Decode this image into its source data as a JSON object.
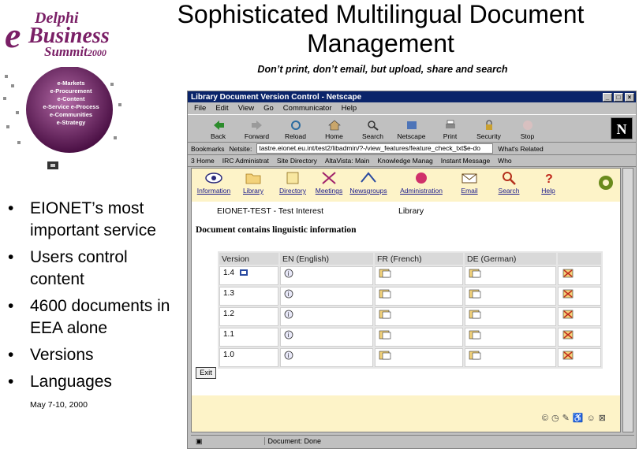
{
  "slide": {
    "logo": {
      "line1": "Delphi",
      "line2": "Business",
      "line3": "Summit",
      "year": "2000",
      "e": "e"
    },
    "title": "Sophisticated Multilingual Document Management",
    "subtitle": "Don’t print, don’t email, but upload, share and search",
    "globe_labels": [
      "e-Markets",
      "e-Procurement",
      "e-Content",
      "e-Service",
      "e-Process",
      "e-Communities",
      "e-Strategy"
    ],
    "bullets": [
      "EIONET’s most important service",
      "Users control content",
      "4600 documents in EEA alone",
      "Versions",
      "Languages"
    ],
    "date": "May 7-10, 2000"
  },
  "browser": {
    "title": "Library Document Version Control - Netscape",
    "menu": [
      "File",
      "Edit",
      "View",
      "Go",
      "Communicator",
      "Help"
    ],
    "toolbar": [
      "Back",
      "Forward",
      "Reload",
      "Home",
      "Search",
      "Netscape",
      "Print",
      "Security",
      "Stop"
    ],
    "location_label": "Bookmarks",
    "netsite_label": "Netsite:",
    "location_value": "tastre.eionet.eu.int/test2/libadmin/?-/view_features/feature_check_txt$e-do",
    "whats_related": "What's Related",
    "links": [
      "3 Home",
      "IRC Administrat",
      "Site Directory",
      "AltaVista: Main",
      "Knowledge Manag",
      "Instant Message",
      "Who"
    ],
    "status": "Document: Done"
  },
  "page": {
    "nav": [
      "Information",
      "Library",
      "Directory",
      "Meetings",
      "Newsgroups",
      "Administration",
      "Email",
      "Search",
      "Help"
    ],
    "crumb_left": "EIONET-TEST - Test Interest",
    "crumb_right": "Library",
    "heading": "Document contains linguistic information",
    "table_headers": [
      "Version",
      "EN (English)",
      "FR (French)",
      "DE (German)",
      ""
    ],
    "versions": [
      "1.4",
      "1.3",
      "1.2",
      "1.1",
      "1.0"
    ],
    "exit_label": "Exit"
  },
  "colors": {
    "brand": "#7a1f66",
    "titlebar": "#0a246a",
    "band": "#fdf3c8"
  }
}
